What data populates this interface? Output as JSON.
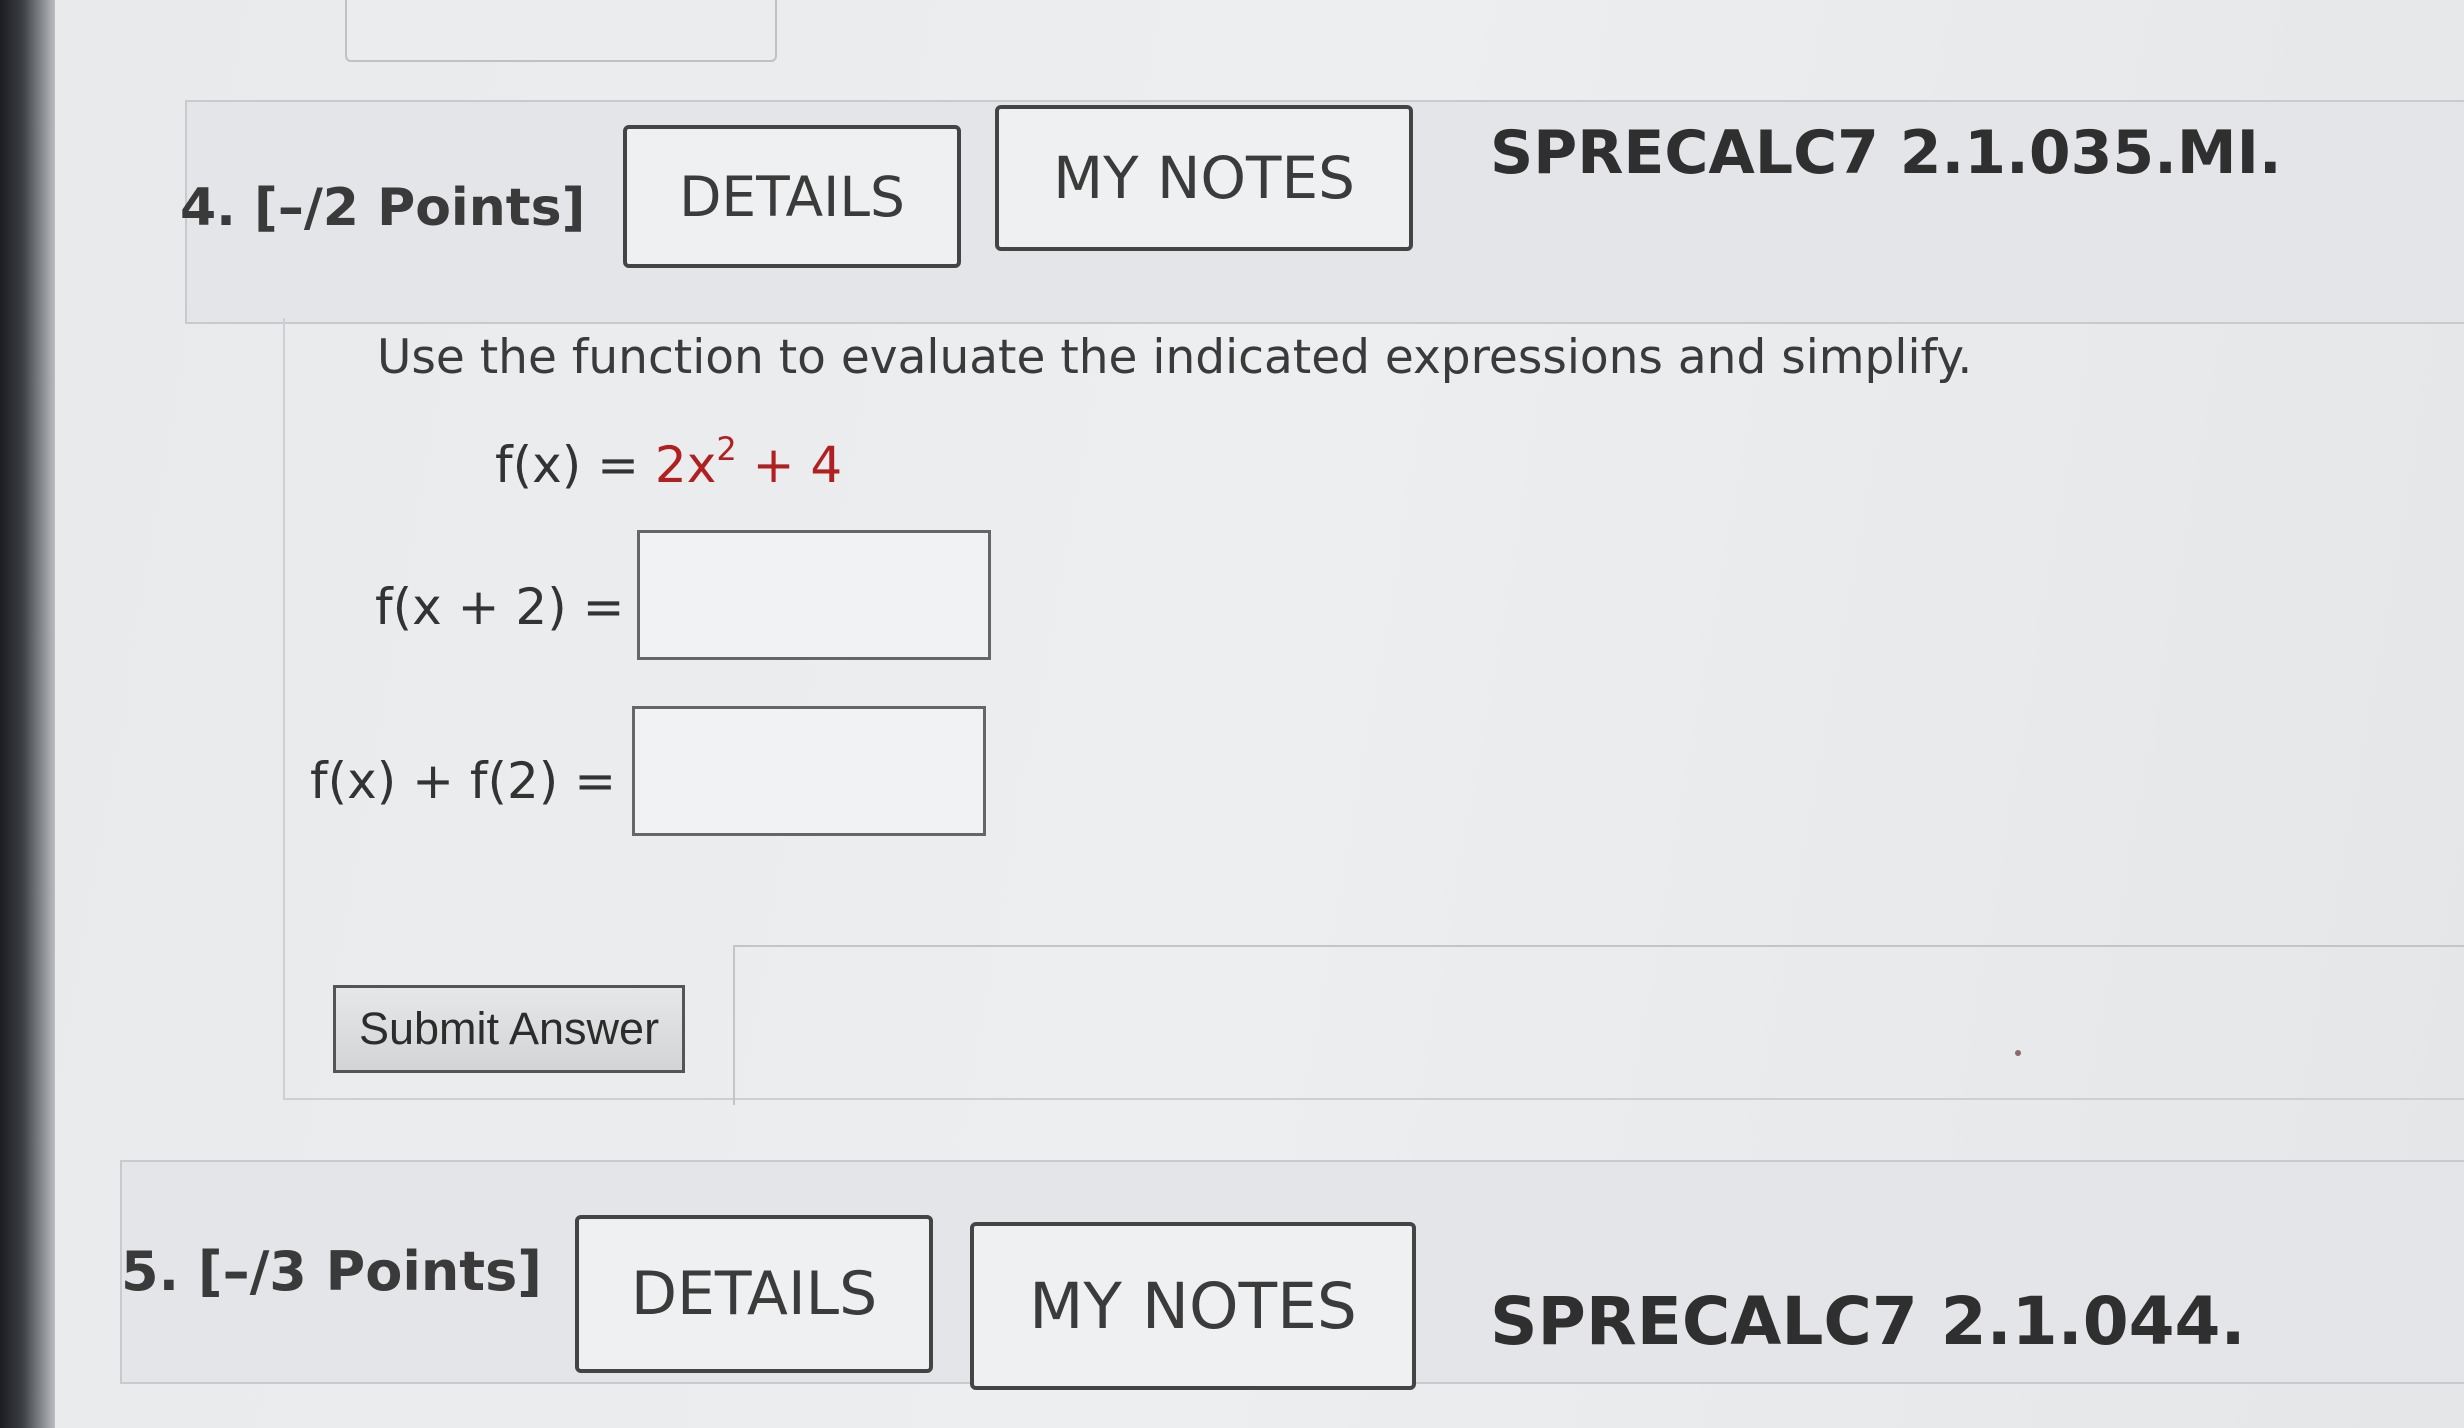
{
  "question4": {
    "number": "4.",
    "points": "[–/2 Points]",
    "details_label": "DETAILS",
    "notes_label": "MY NOTES",
    "code": "SPRECALC7 2.1.035.MI.",
    "instruction": "Use the function to evaluate the indicated expressions and simplify.",
    "function": {
      "lhs": "f(x) =",
      "coef": "2x",
      "exp": "2",
      "plus": " + 4"
    },
    "expr1_label": "f(x + 2) =",
    "expr1_value": "",
    "expr2_label": "f(x) + f(2) =",
    "expr2_value": "",
    "submit_label": "Submit Answer"
  },
  "question5": {
    "number": "5.",
    "points": "[–/3 Points]",
    "details_label": "DETAILS",
    "notes_label": "MY NOTES",
    "code": "SPRECALC7 2.1.044."
  }
}
